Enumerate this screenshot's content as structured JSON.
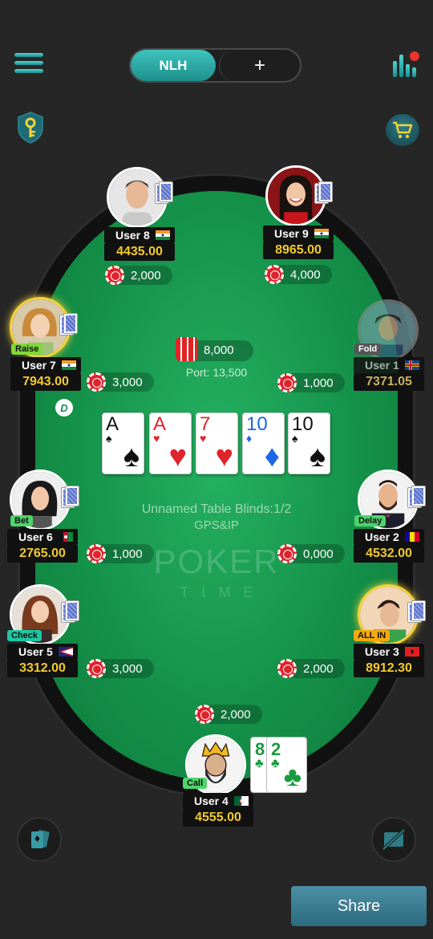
{
  "header": {
    "tab_active": "NLH",
    "tab_add": "+"
  },
  "table": {
    "pot_amount": "8,000",
    "port_text": "Port: 13,500",
    "info_line": "Unnamed Table Blinds:1/2",
    "info_line2": "GPS&IP",
    "logo_text": "POKER",
    "logo_sub": "TIME",
    "dealer_label": "D"
  },
  "community_cards": [
    {
      "rank": "A",
      "suit": "♠",
      "color": "black"
    },
    {
      "rank": "A",
      "suit": "♥",
      "color": "red"
    },
    {
      "rank": "7",
      "suit": "♥",
      "color": "red"
    },
    {
      "rank": "10",
      "suit": "♦",
      "color": "blue"
    },
    {
      "rank": "10",
      "suit": "♠",
      "color": "black"
    }
  ],
  "players": {
    "user8": {
      "name": "User 8",
      "money": "4435.00",
      "bet": "2,000",
      "flag": "india"
    },
    "user9": {
      "name": "User 9",
      "money": "8965.00",
      "bet": "4,000",
      "flag": "india"
    },
    "user7": {
      "name": "User 7",
      "money": "7943.00",
      "bet": "3,000",
      "action": "Raise",
      "flag": "india"
    },
    "user1": {
      "name": "User 1",
      "money": "7371.05",
      "bet": "1,000",
      "action": "Fold",
      "flag": "aland"
    },
    "user6": {
      "name": "User 6",
      "money": "2765.00",
      "bet": "1,000",
      "action": "Bet",
      "flag": "afghanistan"
    },
    "user2": {
      "name": "User 2",
      "money": "4532.00",
      "bet": "0,000",
      "action": "Delay",
      "flag": "andorra"
    },
    "user5": {
      "name": "User 5",
      "money": "3312.00",
      "bet": "3,000",
      "action": "Check",
      "flag": "american-samoa"
    },
    "user3": {
      "name": "User 3",
      "money": "8912.30",
      "bet": "2,000",
      "action": "ALL IN",
      "flag": "albania"
    },
    "user4": {
      "name": "User 4",
      "money": "4555.00",
      "bet": "2,000",
      "action": "Call",
      "flag": "algeria",
      "cards": [
        {
          "rank": "8",
          "suit": "♣"
        },
        {
          "rank": "2",
          "suit": "♣"
        }
      ]
    }
  },
  "footer": {
    "share_label": "Share"
  },
  "colors": {
    "felt": "#15924a",
    "accent": "#1e8f8c",
    "money": "#f2cb2a",
    "background": "#262626"
  },
  "icons": {
    "menu": "menu-icon",
    "stats": "stats-icon",
    "key": "key-shield-icon",
    "cart": "cart-icon",
    "cards": "cards-icon",
    "chat_off": "chat-off-icon"
  }
}
